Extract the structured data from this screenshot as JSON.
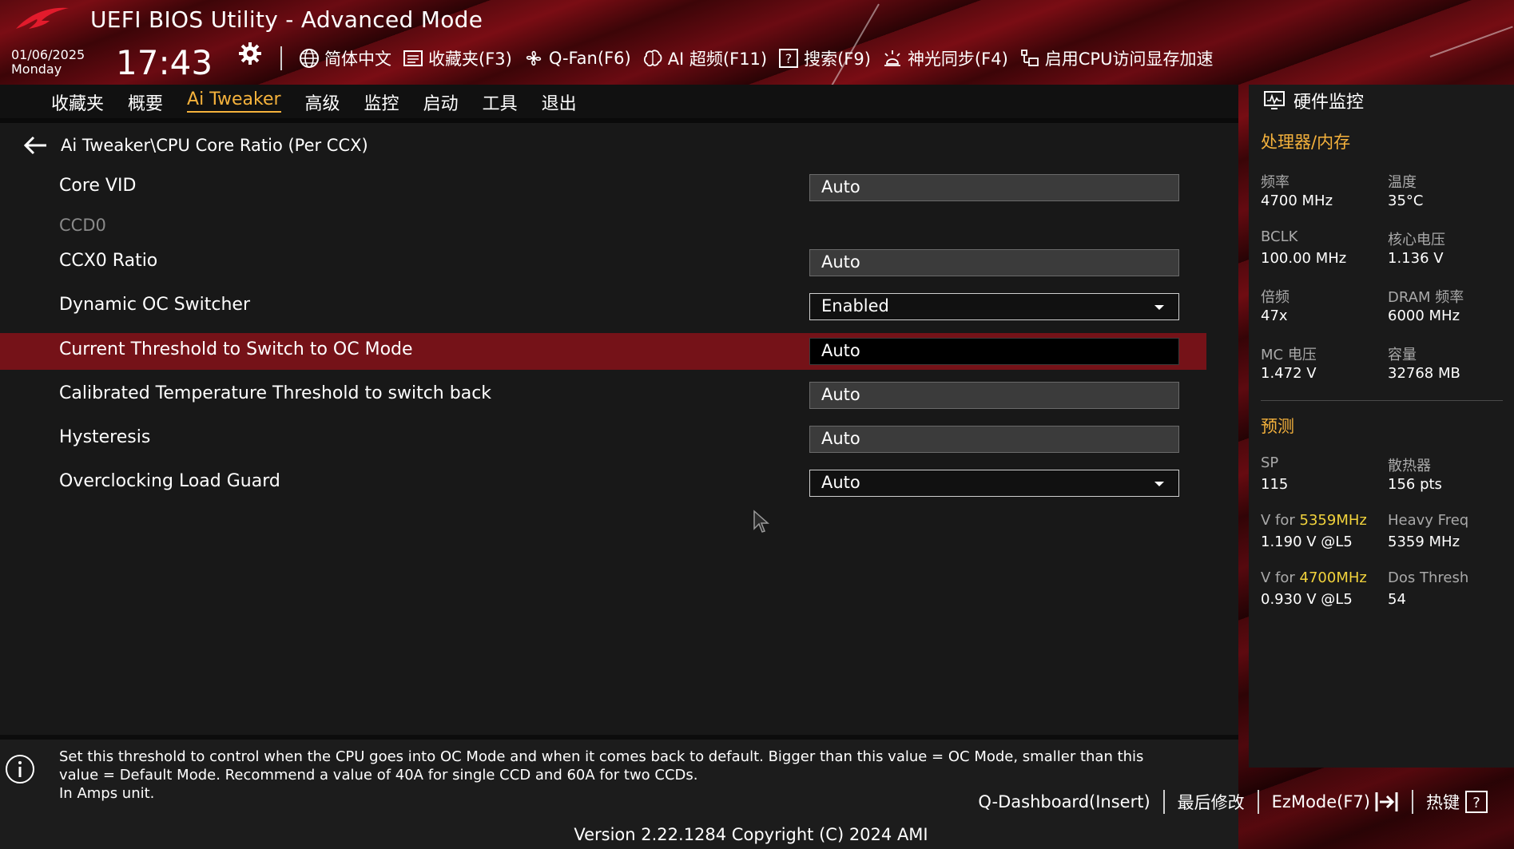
{
  "header": {
    "title": "UEFI BIOS Utility - Advanced Mode",
    "date": "01/06/2025",
    "weekday": "Monday",
    "time": "17:43",
    "toolbar": [
      {
        "icon": "globe-icon",
        "label": "简体中文"
      },
      {
        "icon": "favorites-list-icon",
        "label": "收藏夹(F3)"
      },
      {
        "icon": "fan-icon",
        "label": "Q-Fan(F6)"
      },
      {
        "icon": "ai-brain-icon",
        "label": "AI 超频(F11)"
      },
      {
        "icon": "search-question-icon",
        "label": "搜索(F9)"
      },
      {
        "icon": "aura-light-icon",
        "label": "神光同步(F4)"
      },
      {
        "icon": "resizable-bar-icon",
        "label": "启用CPU访问显存加速"
      }
    ]
  },
  "tabs": [
    {
      "label": "收藏夹",
      "active": false
    },
    {
      "label": "概要",
      "active": false
    },
    {
      "label": "Ai Tweaker",
      "active": true
    },
    {
      "label": "高级",
      "active": false
    },
    {
      "label": "监控",
      "active": false
    },
    {
      "label": "启动",
      "active": false
    },
    {
      "label": "工具",
      "active": false
    },
    {
      "label": "退出",
      "active": false
    }
  ],
  "breadcrumb": "Ai Tweaker\\CPU Core Ratio (Per CCX)",
  "settings": [
    {
      "label": "Core VID",
      "value": "Auto",
      "type": "text"
    },
    {
      "label": "CCD0",
      "value": null,
      "type": "header"
    },
    {
      "label": "CCX0 Ratio",
      "value": "Auto",
      "type": "text"
    },
    {
      "label": "Dynamic OC Switcher",
      "value": "Enabled",
      "type": "select"
    },
    {
      "label": "Current Threshold to Switch to OC Mode",
      "value": "Auto",
      "type": "text",
      "selected": true
    },
    {
      "label": "Calibrated Temperature Threshold to switch back",
      "value": "Auto",
      "type": "text"
    },
    {
      "label": "Hysteresis",
      "value": "Auto",
      "type": "text"
    },
    {
      "label": "Overclocking Load Guard",
      "value": "Auto",
      "type": "select"
    }
  ],
  "help": {
    "text": "Set this threshold to control when the CPU goes into OC Mode and when it comes back to default. Bigger than this value = OC Mode, smaller than this value = Default Mode. Recommend a value of 40A for single CCD and 60A for two CCDs.\nIn Amps unit."
  },
  "monitor": {
    "title": "硬件监控",
    "cpu_section": "处理器/内存",
    "cpu": [
      {
        "label": "频率",
        "value": "4700 MHz"
      },
      {
        "label": "温度",
        "value": "35°C"
      },
      {
        "label": "BCLK",
        "value": "100.00 MHz"
      },
      {
        "label": "核心电压",
        "value": "1.136 V"
      },
      {
        "label": "倍频",
        "value": "47x"
      },
      {
        "label": "DRAM 频率",
        "value": "6000 MHz"
      },
      {
        "label": "MC 电压",
        "value": "1.472 V"
      },
      {
        "label": "容量",
        "value": "32768 MB"
      }
    ],
    "predict_section": "预测",
    "predict": {
      "sp_label": "SP",
      "sp_value": "115",
      "cooler_label": "散热器",
      "cooler_value": "156 pts",
      "v1_prefix": "V for ",
      "v1_freq": "5359MHz",
      "v1_value": "1.190 V @L5",
      "heavy_label": "Heavy Freq",
      "heavy_value": "5359 MHz",
      "v2_prefix": "V for ",
      "v2_freq": "4700MHz",
      "v2_value": "0.930 V @L5",
      "dos_label": "Dos Thresh",
      "dos_value": "54"
    }
  },
  "footer": {
    "items": [
      {
        "label": "Q-Dashboard(Insert)"
      },
      {
        "label": "最后修改"
      },
      {
        "label": "EzMode(F7)"
      },
      {
        "label": "热键"
      }
    ],
    "version": "Version 2.22.1284 Copyright (C) 2024 AMI"
  },
  "colors": {
    "accent": "#f5b23c",
    "selected_row": "#751218",
    "highlight_freq": "#f2d33c"
  }
}
